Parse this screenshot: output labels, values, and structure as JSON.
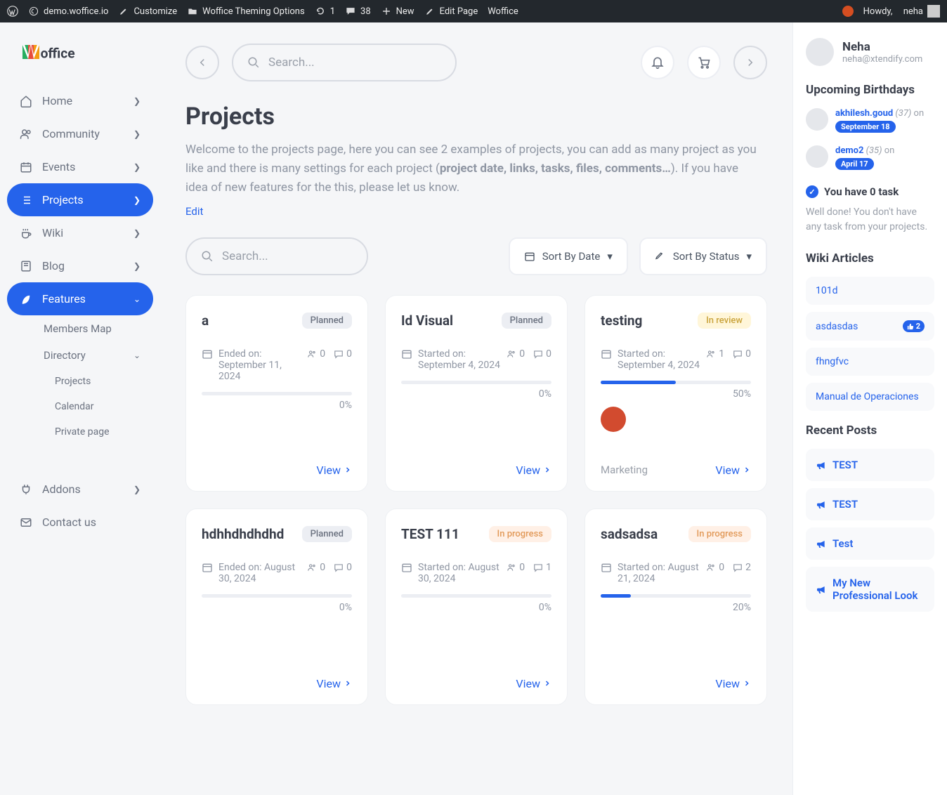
{
  "admin_bar": {
    "site": "demo.woffice.io",
    "customize": "Customize",
    "theming": "Woffice Theming Options",
    "updates": "1",
    "comments": "38",
    "new": "New",
    "edit_page": "Edit Page",
    "app_name": "Woffice",
    "howdy_prefix": "Howdy,",
    "howdy_name": "neha"
  },
  "sidebar": {
    "items": [
      {
        "label": "Home",
        "icon": "home"
      },
      {
        "label": "Community",
        "icon": "users"
      },
      {
        "label": "Events",
        "icon": "calendar"
      },
      {
        "label": "Projects",
        "icon": "list"
      },
      {
        "label": "Wiki",
        "icon": "coffee"
      },
      {
        "label": "Blog",
        "icon": "book"
      },
      {
        "label": "Features",
        "icon": "leaf"
      }
    ],
    "sub": [
      {
        "label": "Members Map"
      },
      {
        "label": "Directory"
      },
      {
        "label": "Projects"
      },
      {
        "label": "Calendar"
      },
      {
        "label": "Private page"
      }
    ],
    "addons": "Addons",
    "contact": "Contact us"
  },
  "topbar": {
    "search_placeholder": "Search..."
  },
  "page": {
    "title": "Projects",
    "desc1": "Welcome to the projects page, here you can see 2 examples of projects, you can add as many project as you like and there is many settings for each project (",
    "desc_bold": "project date, links, tasks, files, comments…",
    "desc2": "). If you have idea of new features for the this, please let us know.",
    "edit_link": "Edit"
  },
  "filters": {
    "search_placeholder": "Search...",
    "sort_date": "Sort By Date",
    "sort_status": "Sort By Status"
  },
  "projects": [
    {
      "title": "a",
      "status": "Planned",
      "status_class": "planned",
      "date_label": "Ended on: September 11, 2024",
      "members": "0",
      "comments": "0",
      "progress": 0,
      "progress_label": "0%",
      "tag": "",
      "view": "View",
      "avatars": 0
    },
    {
      "title": "Id Visual",
      "status": "Planned",
      "status_class": "planned",
      "date_label": "Started on: September 4, 2024",
      "members": "0",
      "comments": "0",
      "progress": 0,
      "progress_label": "0%",
      "tag": "",
      "view": "View",
      "avatars": 0
    },
    {
      "title": "testing",
      "status": "In review",
      "status_class": "inreview",
      "date_label": "Started on: September 4, 2024",
      "members": "1",
      "comments": "0",
      "progress": 50,
      "progress_label": "50%",
      "tag": "Marketing",
      "view": "View",
      "avatars": 1
    },
    {
      "title": "hdhhdhdhdhd",
      "status": "Planned",
      "status_class": "planned",
      "date_label": "Ended on: August 30, 2024",
      "members": "0",
      "comments": "0",
      "progress": 0,
      "progress_label": "0%",
      "tag": "",
      "view": "View",
      "avatars": 0
    },
    {
      "title": "TEST 111",
      "status": "In progress",
      "status_class": "inprogress",
      "date_label": "Started on: August 30, 2024",
      "members": "0",
      "comments": "1",
      "progress": 0,
      "progress_label": "0%",
      "tag": "",
      "view": "View",
      "avatars": 0
    },
    {
      "title": "sadsadsa",
      "status": "In progress",
      "status_class": "inprogress",
      "date_label": "Started on: August 21, 2024",
      "members": "0",
      "comments": "2",
      "progress": 20,
      "progress_label": "20%",
      "tag": "",
      "view": "View",
      "avatars": 0
    }
  ],
  "right": {
    "user_name": "Neha",
    "user_email": "neha@xtendify.com",
    "birthdays_title": "Upcoming Birthdays",
    "birthdays": [
      {
        "name": "akhilesh.goud",
        "age": "(37)",
        "on": "on",
        "date": "September 18"
      },
      {
        "name": "demo2",
        "age": "(35)",
        "on": "on",
        "date": "April 17"
      }
    ],
    "task_title": "You have 0 task",
    "task_desc": "Well done! You don't have any task from your projects.",
    "wiki_title": "Wiki Articles",
    "wiki": [
      {
        "title": "101d",
        "likes": ""
      },
      {
        "title": "asdasdas",
        "likes": "2"
      },
      {
        "title": "fhngfvc",
        "likes": ""
      },
      {
        "title": "Manual de Operaciones",
        "likes": ""
      }
    ],
    "posts_title": "Recent Posts",
    "posts": [
      {
        "title": "TEST"
      },
      {
        "title": "TEST"
      },
      {
        "title": "Test"
      },
      {
        "title": "My New Professional Look"
      }
    ]
  }
}
